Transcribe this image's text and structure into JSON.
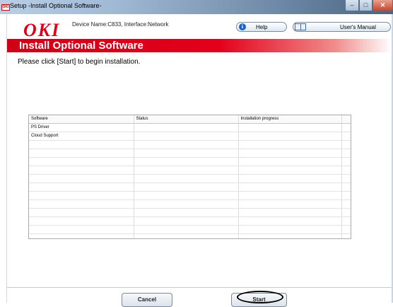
{
  "window": {
    "title": "Setup -Install Optional Software-",
    "app_icon": "OKI",
    "controls": {
      "minimize": "–",
      "maximize": "□",
      "close": "✕"
    }
  },
  "header": {
    "logo": "OKI",
    "device_info": "Device Name:C833, Interface:Network",
    "help_label": "Help",
    "manual_label": "User's Manual"
  },
  "banner": {
    "title": "Install Optional Software"
  },
  "instruction": "Please click [Start] to begin installation.",
  "table": {
    "columns": [
      "Software",
      "Status",
      "Installation progress",
      ""
    ],
    "rows": [
      [
        "PS Driver",
        "",
        "",
        ""
      ],
      [
        "Cloud Support",
        "",
        "",
        ""
      ],
      [
        "",
        "",
        "",
        ""
      ],
      [
        "",
        "",
        "",
        ""
      ],
      [
        "",
        "",
        "",
        ""
      ],
      [
        "",
        "",
        "",
        ""
      ],
      [
        "",
        "",
        "",
        ""
      ],
      [
        "",
        "",
        "",
        ""
      ],
      [
        "",
        "",
        "",
        ""
      ],
      [
        "",
        "",
        "",
        ""
      ],
      [
        "",
        "",
        "",
        ""
      ],
      [
        "",
        "",
        "",
        ""
      ],
      [
        "",
        "",
        "",
        ""
      ],
      [
        "",
        "",
        "",
        ""
      ]
    ]
  },
  "footer": {
    "cancel_label": "Cancel",
    "start_label": "Start"
  },
  "colors": {
    "brand_red": "#e1001a",
    "banner_red": "#d00016"
  }
}
